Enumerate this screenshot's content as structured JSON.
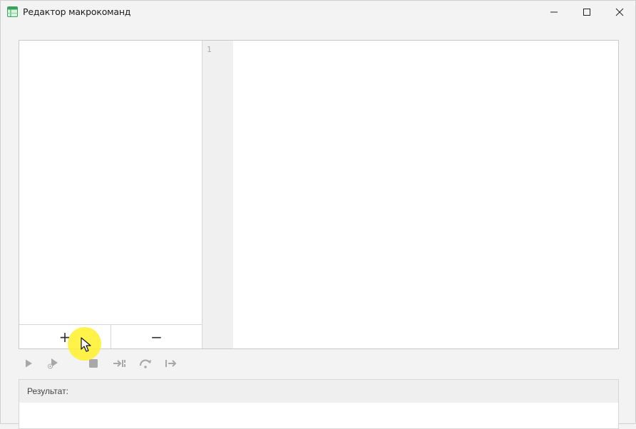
{
  "window": {
    "title": "Редактор макрокоманд",
    "app_icon": "table-icon",
    "controls": [
      "minimize-icon",
      "maximize-icon",
      "close-icon"
    ]
  },
  "macro_list": {
    "items": [],
    "add_label": "+",
    "remove_label": "−"
  },
  "editor": {
    "line_numbers": [
      "1"
    ],
    "code": ""
  },
  "toolbar": {
    "buttons": [
      {
        "name": "run",
        "icon": "play-icon"
      },
      {
        "name": "debug",
        "icon": "debug-run-icon"
      },
      {
        "name": "stop",
        "icon": "stop-icon"
      },
      {
        "name": "step-into",
        "icon": "step-into-icon"
      },
      {
        "name": "step-over",
        "icon": "step-over-icon"
      },
      {
        "name": "step-out",
        "icon": "step-out-icon"
      }
    ]
  },
  "result": {
    "label": "Результат:",
    "text": ""
  },
  "colors": {
    "accent_green": "#3aa35a",
    "disabled_icon": "#a8a8a8",
    "cursor_highlight": "#fff028"
  }
}
